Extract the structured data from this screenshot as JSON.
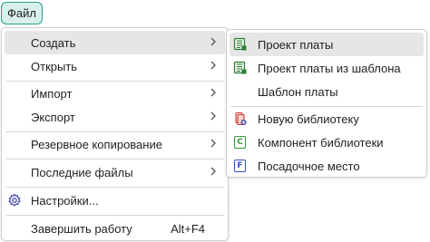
{
  "menubar": {
    "file_label": "Файл"
  },
  "file_menu": {
    "items": [
      {
        "label": "Создать",
        "has_submenu": true
      },
      {
        "label": "Открыть",
        "has_submenu": true
      },
      {
        "label": "Импорт",
        "has_submenu": true
      },
      {
        "label": "Экспорт",
        "has_submenu": true
      },
      {
        "label": "Резервное копирование",
        "has_submenu": true
      },
      {
        "label": "Последние файлы",
        "has_submenu": true
      },
      {
        "label": "Настройки...",
        "icon": "gear-icon"
      },
      {
        "label": "Завершить работу",
        "shortcut": "Alt+F4"
      }
    ]
  },
  "create_submenu": {
    "items": [
      {
        "label": "Проект платы",
        "icon": "board-project-icon"
      },
      {
        "label": "Проект платы из шаблона",
        "icon": "board-template-project-icon"
      },
      {
        "label": "Шаблон платы"
      },
      {
        "label": "Новую библиотеку",
        "icon": "library-icon"
      },
      {
        "label": "Компонент библиотеки",
        "icon": "component-icon",
        "icon_letter": "C"
      },
      {
        "label": "Посадочное место",
        "icon": "footprint-icon",
        "icon_letter": "F"
      }
    ]
  },
  "colors": {
    "accent": "#2a9d8f",
    "highlight": "#e6e6e6",
    "component_icon": "#2e9a3b",
    "footprint_icon": "#3550b5",
    "library_icon": "#c0392b"
  }
}
